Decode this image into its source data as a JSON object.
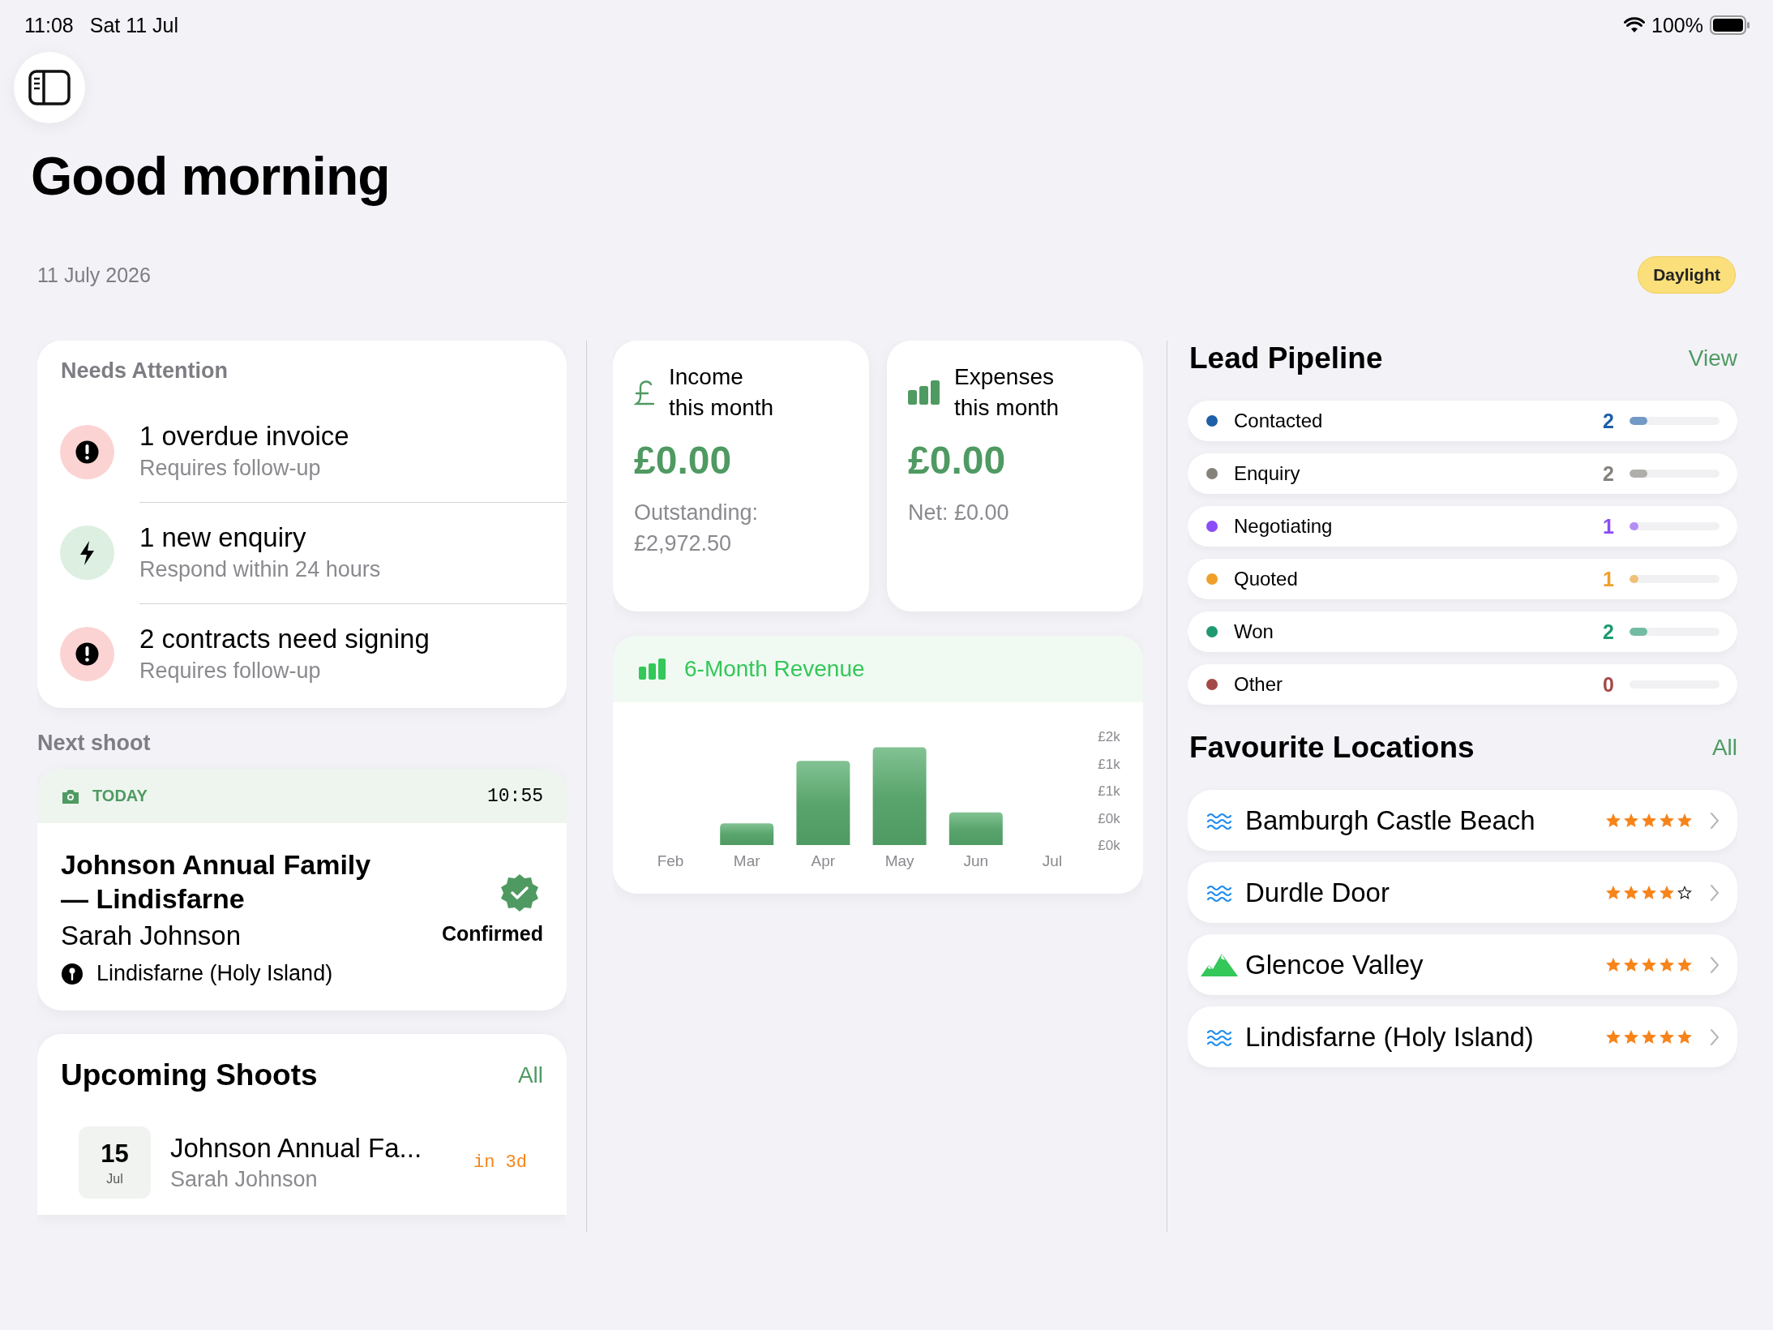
{
  "status_bar": {
    "time": "11:08",
    "date": "Sat 11 Jul",
    "battery": "100%"
  },
  "header": {
    "title": "Good morning",
    "date": "11 July 2026",
    "badge": "Daylight"
  },
  "needs_attention": {
    "title": "Needs Attention",
    "items": [
      {
        "kind": "alert",
        "title": "1 overdue invoice",
        "subtitle": "Requires follow-up"
      },
      {
        "kind": "enquiry",
        "title": "1 new enquiry",
        "subtitle": "Respond within 24 hours"
      },
      {
        "kind": "alert",
        "title": "2 contracts need signing",
        "subtitle": "Requires follow-up"
      }
    ]
  },
  "next_shoot": {
    "label": "Next shoot",
    "day": "TODAY",
    "time": "10:55",
    "title": "Johnson Annual Family — Lindisfarne",
    "client": "Sarah Johnson",
    "location": "Lindisfarne (Holy Island)",
    "status": "Confirmed"
  },
  "upcoming": {
    "title": "Upcoming Shoots",
    "link": "All",
    "items": [
      {
        "day": "15",
        "month": "Jul",
        "title": "Johnson Annual Fa...",
        "client": "Sarah Johnson",
        "due": "in 3d"
      }
    ]
  },
  "stats": [
    {
      "kind": "income",
      "title": "Income this month",
      "amount": "£0.00",
      "note": "Outstanding: £2,972.50"
    },
    {
      "kind": "expenses",
      "title": "Expenses this month",
      "amount": "£0.00",
      "note": "Net: £0.00"
    }
  ],
  "revenue": {
    "title": "6-Month Revenue",
    "chart_data": {
      "type": "bar",
      "categories": [
        "Feb",
        "Mar",
        "Apr",
        "May",
        "Jun",
        "Jul"
      ],
      "series": [
        {
          "color": "#5aa56d",
          "values": [
            0,
            400,
            1550,
            1800,
            600,
            0
          ]
        }
      ],
      "ylim": [
        0,
        2000
      ],
      "yticks": [
        {
          "value": 0,
          "label": "£0k"
        },
        {
          "value": 500,
          "label": "£0k"
        },
        {
          "value": 1000,
          "label": "£1k"
        },
        {
          "value": 1500,
          "label": "£1k"
        },
        {
          "value": 2000,
          "label": "£2k"
        }
      ]
    }
  },
  "pipeline": {
    "title": "Lead Pipeline",
    "link": "View",
    "stages": [
      {
        "name": "Contacted",
        "count": "2",
        "level": 0.2,
        "color": "#1f5fa8"
      },
      {
        "name": "Enquiry",
        "count": "2",
        "level": 0.2,
        "color": "#85827c"
      },
      {
        "name": "Negotiating",
        "count": "1",
        "level": 0.1,
        "color": "#8b4cf7"
      },
      {
        "name": "Quoted",
        "count": "1",
        "level": 0.1,
        "color": "#f0a02a"
      },
      {
        "name": "Won",
        "count": "2",
        "level": 0.2,
        "color": "#1f9a6e"
      },
      {
        "name": "Other",
        "count": "0",
        "color": "#a34a48"
      }
    ]
  },
  "locations": {
    "title": "Favourite Locations",
    "link": "All",
    "items": [
      {
        "kind": "water",
        "name": "Bamburgh Castle Beach",
        "stars": 5
      },
      {
        "kind": "water",
        "name": "Durdle Door",
        "stars": 4
      },
      {
        "kind": "mountain",
        "name": "Glencoe Valley",
        "stars": 5
      },
      {
        "kind": "water",
        "name": "Lindisfarne (Holy Island)",
        "stars": 5
      }
    ]
  }
}
